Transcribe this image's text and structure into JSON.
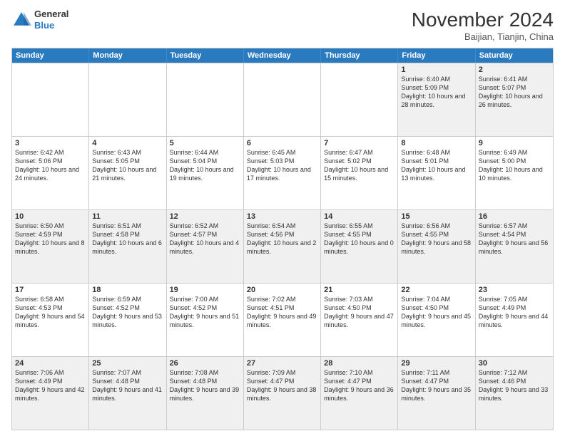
{
  "logo": {
    "general": "General",
    "blue": "Blue"
  },
  "header": {
    "month": "November 2024",
    "location": "Baijian, Tianjin, China"
  },
  "days": [
    "Sunday",
    "Monday",
    "Tuesday",
    "Wednesday",
    "Thursday",
    "Friday",
    "Saturday"
  ],
  "weeks": [
    [
      {
        "day": "",
        "info": ""
      },
      {
        "day": "",
        "info": ""
      },
      {
        "day": "",
        "info": ""
      },
      {
        "day": "",
        "info": ""
      },
      {
        "day": "",
        "info": ""
      },
      {
        "day": "1",
        "info": "Sunrise: 6:40 AM\nSunset: 5:09 PM\nDaylight: 10 hours and 28 minutes."
      },
      {
        "day": "2",
        "info": "Sunrise: 6:41 AM\nSunset: 5:07 PM\nDaylight: 10 hours and 26 minutes."
      }
    ],
    [
      {
        "day": "3",
        "info": "Sunrise: 6:42 AM\nSunset: 5:06 PM\nDaylight: 10 hours and 24 minutes."
      },
      {
        "day": "4",
        "info": "Sunrise: 6:43 AM\nSunset: 5:05 PM\nDaylight: 10 hours and 21 minutes."
      },
      {
        "day": "5",
        "info": "Sunrise: 6:44 AM\nSunset: 5:04 PM\nDaylight: 10 hours and 19 minutes."
      },
      {
        "day": "6",
        "info": "Sunrise: 6:45 AM\nSunset: 5:03 PM\nDaylight: 10 hours and 17 minutes."
      },
      {
        "day": "7",
        "info": "Sunrise: 6:47 AM\nSunset: 5:02 PM\nDaylight: 10 hours and 15 minutes."
      },
      {
        "day": "8",
        "info": "Sunrise: 6:48 AM\nSunset: 5:01 PM\nDaylight: 10 hours and 13 minutes."
      },
      {
        "day": "9",
        "info": "Sunrise: 6:49 AM\nSunset: 5:00 PM\nDaylight: 10 hours and 10 minutes."
      }
    ],
    [
      {
        "day": "10",
        "info": "Sunrise: 6:50 AM\nSunset: 4:59 PM\nDaylight: 10 hours and 8 minutes."
      },
      {
        "day": "11",
        "info": "Sunrise: 6:51 AM\nSunset: 4:58 PM\nDaylight: 10 hours and 6 minutes."
      },
      {
        "day": "12",
        "info": "Sunrise: 6:52 AM\nSunset: 4:57 PM\nDaylight: 10 hours and 4 minutes."
      },
      {
        "day": "13",
        "info": "Sunrise: 6:54 AM\nSunset: 4:56 PM\nDaylight: 10 hours and 2 minutes."
      },
      {
        "day": "14",
        "info": "Sunrise: 6:55 AM\nSunset: 4:55 PM\nDaylight: 10 hours and 0 minutes."
      },
      {
        "day": "15",
        "info": "Sunrise: 6:56 AM\nSunset: 4:55 PM\nDaylight: 9 hours and 58 minutes."
      },
      {
        "day": "16",
        "info": "Sunrise: 6:57 AM\nSunset: 4:54 PM\nDaylight: 9 hours and 56 minutes."
      }
    ],
    [
      {
        "day": "17",
        "info": "Sunrise: 6:58 AM\nSunset: 4:53 PM\nDaylight: 9 hours and 54 minutes."
      },
      {
        "day": "18",
        "info": "Sunrise: 6:59 AM\nSunset: 4:52 PM\nDaylight: 9 hours and 53 minutes."
      },
      {
        "day": "19",
        "info": "Sunrise: 7:00 AM\nSunset: 4:52 PM\nDaylight: 9 hours and 51 minutes."
      },
      {
        "day": "20",
        "info": "Sunrise: 7:02 AM\nSunset: 4:51 PM\nDaylight: 9 hours and 49 minutes."
      },
      {
        "day": "21",
        "info": "Sunrise: 7:03 AM\nSunset: 4:50 PM\nDaylight: 9 hours and 47 minutes."
      },
      {
        "day": "22",
        "info": "Sunrise: 7:04 AM\nSunset: 4:50 PM\nDaylight: 9 hours and 45 minutes."
      },
      {
        "day": "23",
        "info": "Sunrise: 7:05 AM\nSunset: 4:49 PM\nDaylight: 9 hours and 44 minutes."
      }
    ],
    [
      {
        "day": "24",
        "info": "Sunrise: 7:06 AM\nSunset: 4:49 PM\nDaylight: 9 hours and 42 minutes."
      },
      {
        "day": "25",
        "info": "Sunrise: 7:07 AM\nSunset: 4:48 PM\nDaylight: 9 hours and 41 minutes."
      },
      {
        "day": "26",
        "info": "Sunrise: 7:08 AM\nSunset: 4:48 PM\nDaylight: 9 hours and 39 minutes."
      },
      {
        "day": "27",
        "info": "Sunrise: 7:09 AM\nSunset: 4:47 PM\nDaylight: 9 hours and 38 minutes."
      },
      {
        "day": "28",
        "info": "Sunrise: 7:10 AM\nSunset: 4:47 PM\nDaylight: 9 hours and 36 minutes."
      },
      {
        "day": "29",
        "info": "Sunrise: 7:11 AM\nSunset: 4:47 PM\nDaylight: 9 hours and 35 minutes."
      },
      {
        "day": "30",
        "info": "Sunrise: 7:12 AM\nSunset: 4:46 PM\nDaylight: 9 hours and 33 minutes."
      }
    ]
  ]
}
